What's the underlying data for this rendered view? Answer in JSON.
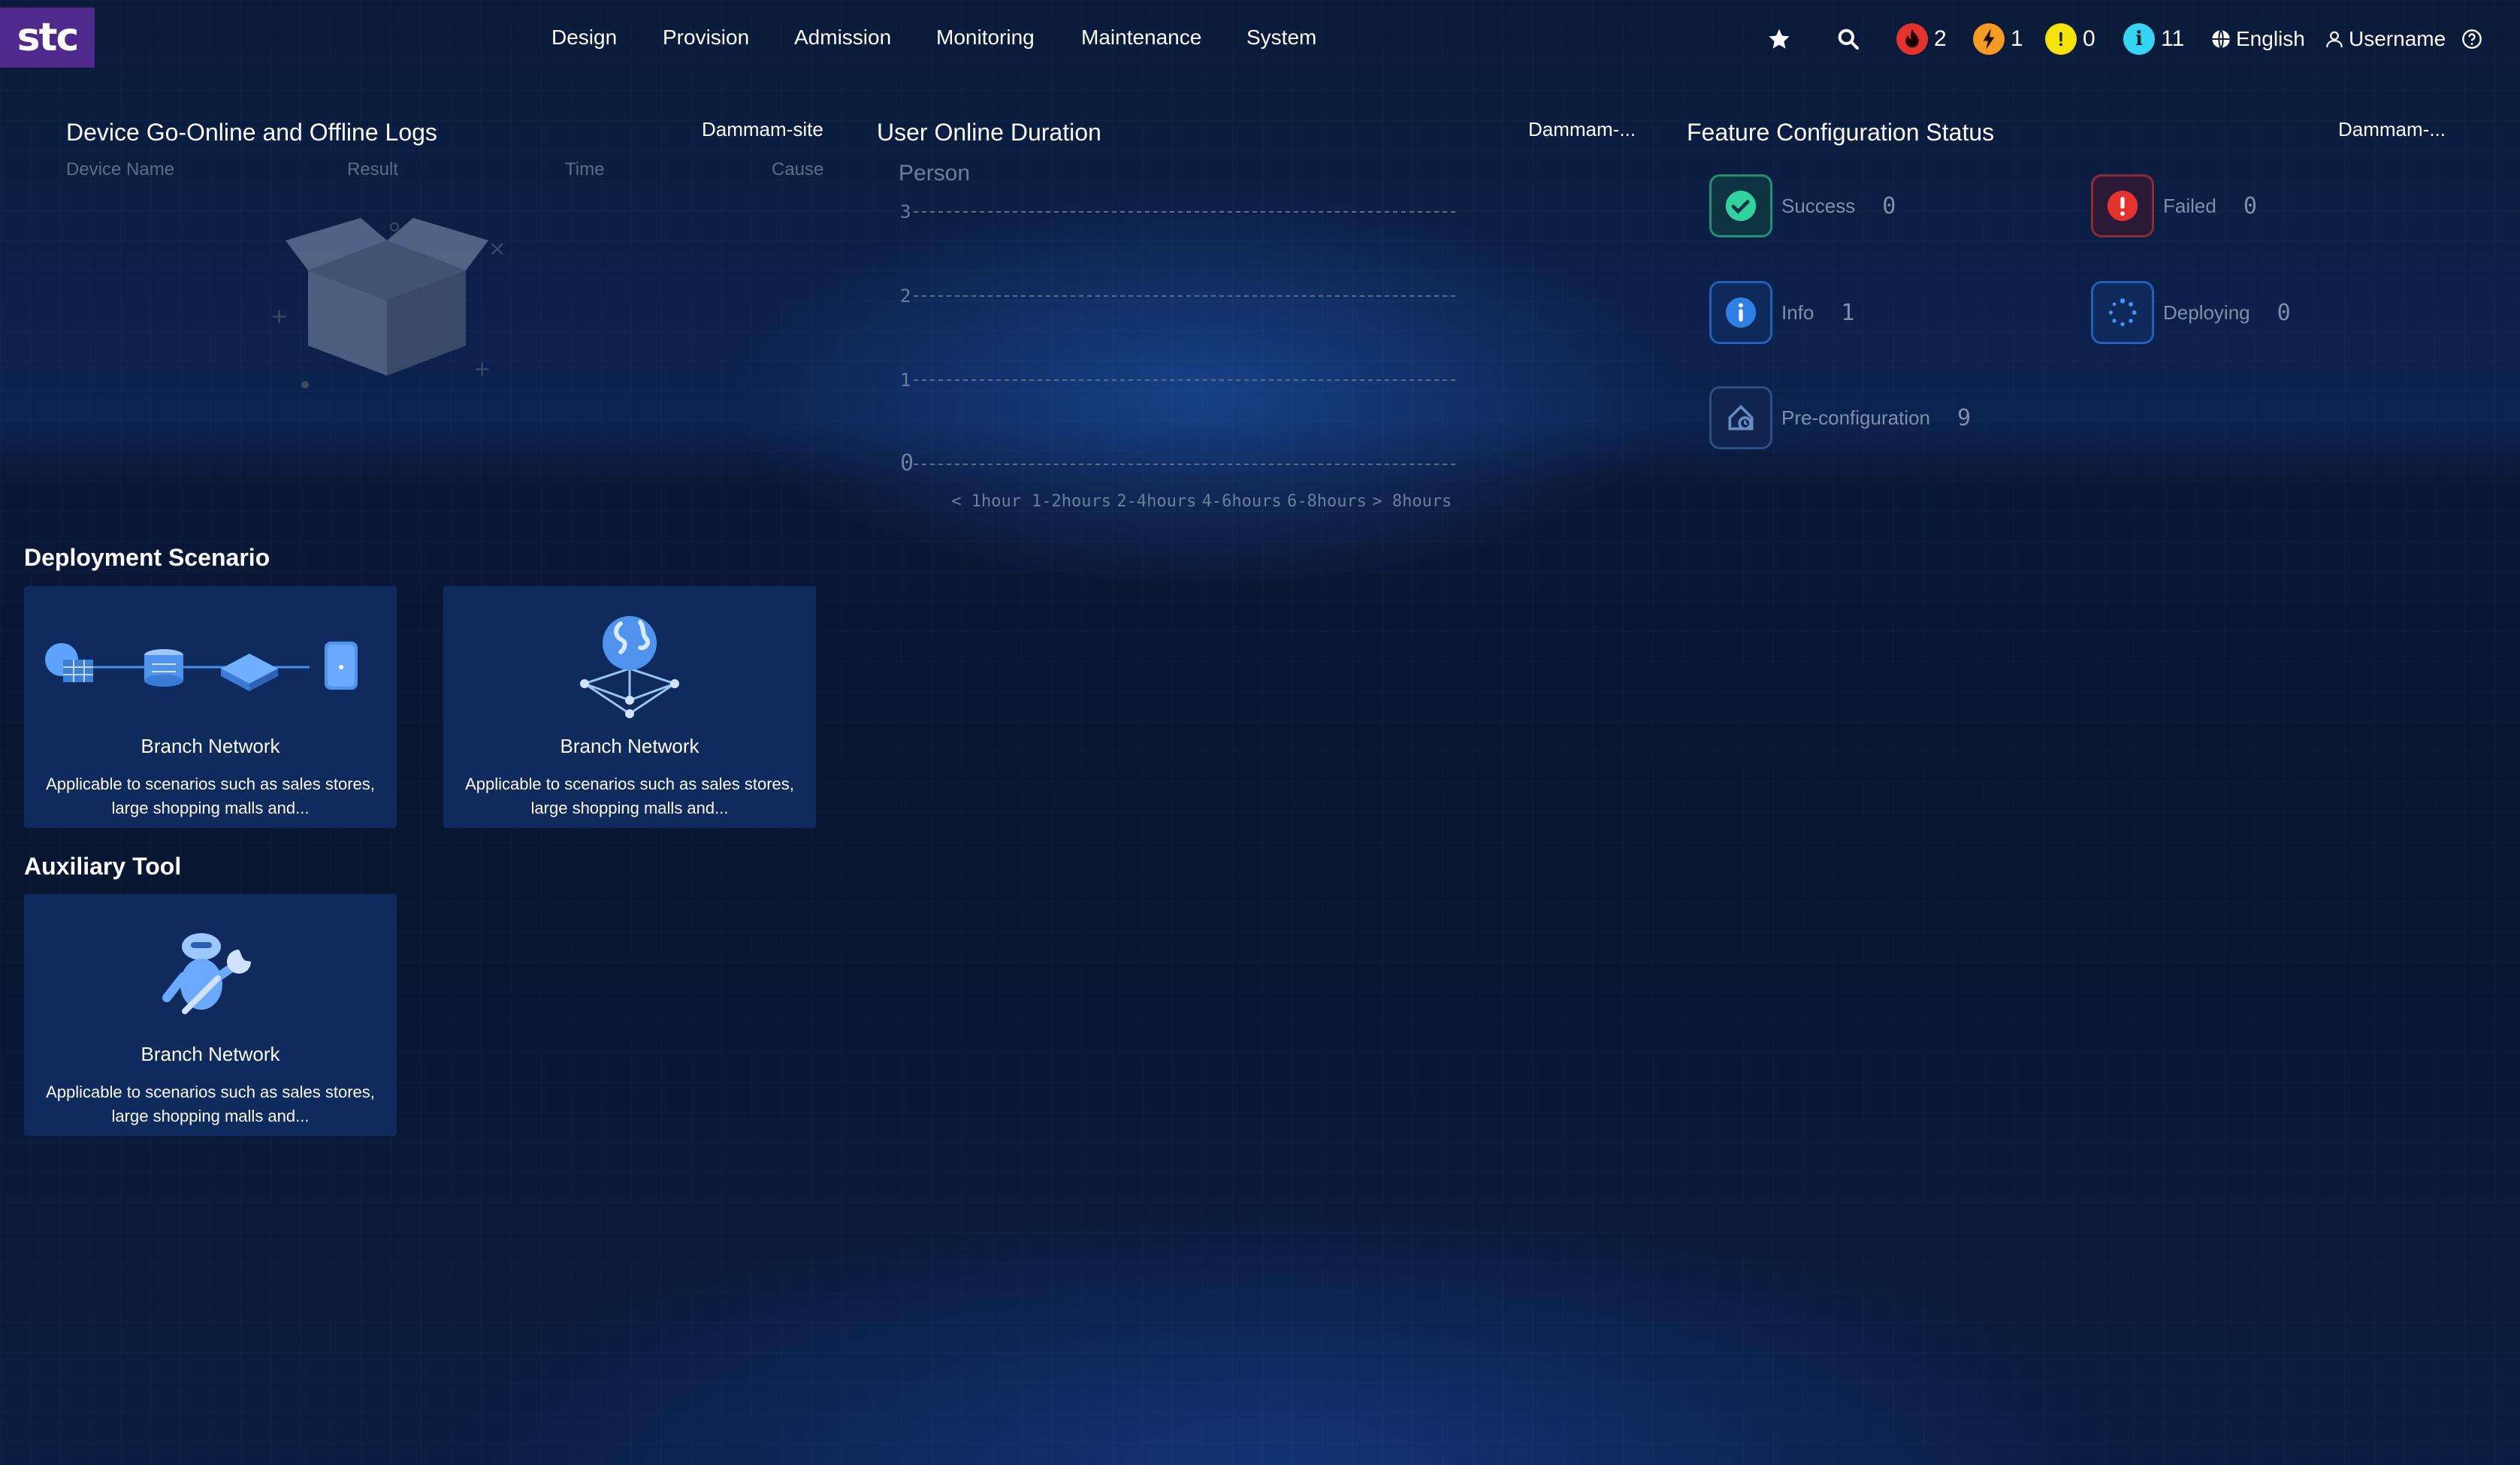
{
  "brand": {
    "logo_text": "stc",
    "logo_bg": "#4f2a8c"
  },
  "nav": {
    "items": [
      "Design",
      "Provision",
      "Admission",
      "Monitoring",
      "Maintenance",
      "System"
    ]
  },
  "header": {
    "alarms": {
      "critical": "2",
      "major": "1",
      "minor": "0",
      "info": "11"
    },
    "alarm_colors": {
      "critical": "#e5322d",
      "major": "#f59a23",
      "minor": "#f5e400",
      "info": "#33d6f2"
    },
    "language": "English",
    "username": "Username",
    "icons": [
      "star-icon",
      "search-icon",
      "globe-icon",
      "user-icon",
      "help-icon"
    ]
  },
  "device_logs": {
    "title": "Device Go-Online and Offline Logs",
    "site": "Dammam-site",
    "columns": [
      "Device Name",
      "Result",
      "Time",
      "Cause"
    ]
  },
  "online_duration": {
    "title": "User Online Duration",
    "site": "Dammam-..."
  },
  "chart_data": {
    "type": "bar",
    "title": "User Online Duration",
    "ylabel": "Person",
    "xlabel": "",
    "categories": [
      "< 1hour",
      "1-2hours",
      "2-4hours",
      "4-6hours",
      "6-8hours",
      "> 8hours"
    ],
    "values": [
      0,
      0,
      0,
      0,
      0,
      0
    ],
    "ylim": [
      0,
      3
    ],
    "yticks": [
      "0",
      "1",
      "2",
      "3"
    ],
    "grid": true
  },
  "feature_config": {
    "title": "Feature Configuration Status",
    "site": "Dammam-...",
    "statuses": [
      {
        "label": "Success",
        "count": "0",
        "color": "#2fd3a0"
      },
      {
        "label": "Failed",
        "count": "0",
        "color": "#e5322d"
      },
      {
        "label": "Info",
        "count": "1",
        "color": "#2f7fe5"
      },
      {
        "label": "Deploying",
        "count": "0",
        "color": "#2f7fe5"
      },
      {
        "label": "Pre-configuration",
        "count": "9",
        "color": "#3c6ab0"
      }
    ]
  },
  "deployment": {
    "title": "Deployment Scenario",
    "cards": [
      {
        "title": "Branch Network",
        "desc": "Applicable to scenarios such as sales stores, large shopping malls and..."
      },
      {
        "title": "Branch Network",
        "desc": "Applicable to scenarios such as sales stores, large shopping malls and..."
      }
    ]
  },
  "auxiliary": {
    "title": "Auxiliary Tool",
    "cards": [
      {
        "title": "Branch Network",
        "desc": "Applicable to scenarios such as sales stores, large shopping malls and..."
      }
    ]
  }
}
